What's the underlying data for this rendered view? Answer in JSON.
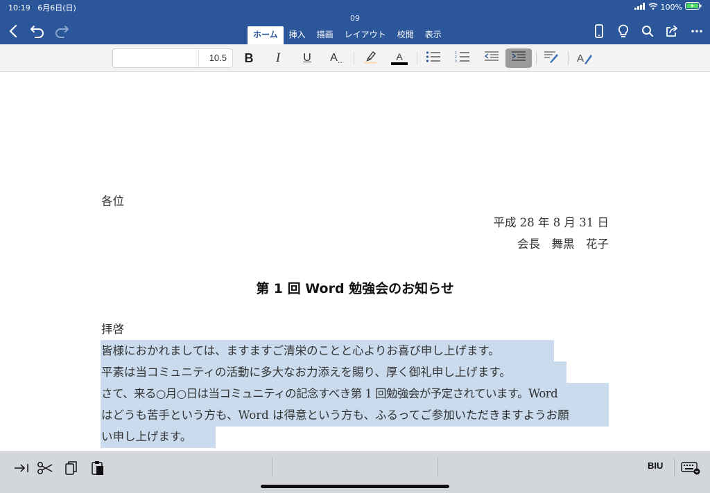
{
  "status_bar": {
    "time": "10:19",
    "date": "6月6日(日)",
    "battery": "100%"
  },
  "document_title": "09",
  "tabs": [
    {
      "label": "ホーム",
      "active": true
    },
    {
      "label": "挿入",
      "active": false
    },
    {
      "label": "描画",
      "active": false
    },
    {
      "label": "レイアウト",
      "active": false
    },
    {
      "label": "校閲",
      "active": false
    },
    {
      "label": "表示",
      "active": false
    }
  ],
  "ribbon": {
    "font_name": "",
    "font_size": "10.5",
    "bold": "B",
    "italic": "I",
    "underline": "U",
    "font_effects": "A",
    "font_color_glyph": "A",
    "styles_glyph": "A"
  },
  "document": {
    "salutation": "各位",
    "date": "平成 28 年 8 月 31 日",
    "sender": "会長　舞黒　花子",
    "heading": "第 1 回 Word 勉強会のお知らせ",
    "opening": "拝啓",
    "lines": [
      "皆様におかれましては、ますますご清栄のことと心よりお喜び申し上げます。",
      "平素は当コミュニティの活動に多大なお力添えを賜り、厚く御礼申し上げます。",
      "さて、来る○月○日は当コミュニティの記念すべき第 1 回勉強会が予定されています。Word",
      "はどうも苦手という方も、Word は得意という方も、ふるってご参加いただきますようお願",
      "い申し上げます。"
    ]
  },
  "bottom_bar": {
    "biu": "BIU"
  },
  "colors": {
    "header": "#2b579a",
    "selection": "#c9dbed",
    "ribbon": "#f3f3f3"
  }
}
